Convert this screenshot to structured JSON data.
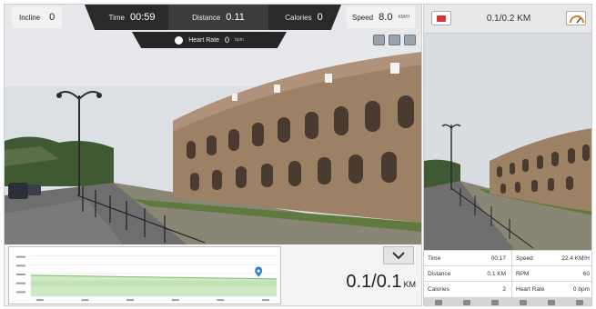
{
  "topbar": {
    "incline_label": "Incline",
    "incline_value": "0",
    "time_label": "Time",
    "time_value": "00:59",
    "distance_label": "Distance",
    "distance_value": "0.11",
    "calories_label": "Calories",
    "calories_value": "0",
    "speed_label": "Speed",
    "speed_value": "8.0",
    "speed_unit": "KM/H"
  },
  "heart_rate": {
    "label": "Heart Rate",
    "value": "0",
    "unit": "bpm"
  },
  "view_icons": [
    "map-view-icon",
    "street-view-icon",
    "photo-view-icon"
  ],
  "bottom": {
    "distance_value": "0.1/0.1",
    "distance_unit": "KM",
    "collapse_icon": "chevron-down-icon"
  },
  "side": {
    "title": "0.1/0.2 KM",
    "stats": [
      {
        "label1": "Time",
        "value1": "00:17",
        "label2": "Speed",
        "value2": "22.4 KM/H"
      },
      {
        "label1": "Distance",
        "value1": "0.1 KM",
        "label2": "RPM",
        "value2": "60"
      },
      {
        "label1": "Calories",
        "value1": "2",
        "label2": "Heart Rate",
        "value2": "0 bpm"
      }
    ],
    "footer_icons": [
      "speed-icon",
      "map-icon",
      "settings-icon",
      "expand-icon",
      "globe-icon",
      "power-icon"
    ]
  },
  "colors": {
    "dark_bar": "#2a2a2a",
    "record_red": "#dd3333",
    "sky": "#d7dbe0",
    "stone": "#9b7f63",
    "elevation_fill": "#cdeac4",
    "marker_blue": "#2a7fd0"
  }
}
